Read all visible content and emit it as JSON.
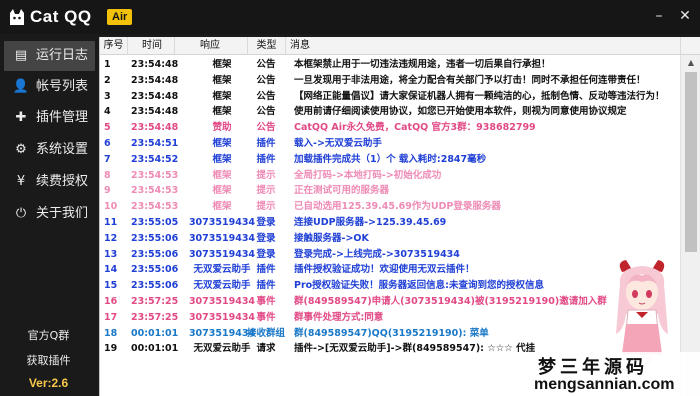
{
  "app": {
    "title": "Cat QQ",
    "badge": "Air",
    "window_controls": {
      "minimize": "–",
      "close": "✕"
    }
  },
  "sidebar": {
    "items": [
      {
        "label": "运行日志",
        "icon": "log-icon",
        "glyph": "▤",
        "active": true
      },
      {
        "label": "帐号列表",
        "icon": "user-icon",
        "glyph": "👤",
        "active": false
      },
      {
        "label": "插件管理",
        "icon": "puzzle-icon",
        "glyph": "✚",
        "active": false
      },
      {
        "label": "系统设置",
        "icon": "gear-icon",
        "glyph": "⚙",
        "active": false
      },
      {
        "label": "续费授权",
        "icon": "yen-icon",
        "glyph": "¥",
        "active": false
      },
      {
        "label": "关于我们",
        "icon": "power-icon",
        "glyph": "⏻",
        "active": false
      }
    ],
    "official_group": "官方Q群",
    "get_plugins": "获取插件",
    "version": "Ver:2.6"
  },
  "log_table": {
    "columns": [
      "序号",
      "时间",
      "响应",
      "类型",
      "消息"
    ],
    "colors": {
      "black": "#111111",
      "pink": "#e24a86",
      "light_pink": "#ee8cb6",
      "blue": "#1f3fd6",
      "red": "#d61818",
      "cyan": "#1a78c8"
    },
    "rows": [
      {
        "idx": "1",
        "time": "23:54:48",
        "resp": "框架",
        "type": "公告",
        "msg": "本框架禁止用于一切违法违规用途，违者一切后果自行承担！",
        "color": "#111111"
      },
      {
        "idx": "2",
        "time": "23:54:48",
        "resp": "框架",
        "type": "公告",
        "msg": "一旦发现用于非法用途，将全力配合有关部门予以打击！同时不承担任何连带责任！",
        "color": "#111111"
      },
      {
        "idx": "3",
        "time": "23:54:48",
        "resp": "框架",
        "type": "公告",
        "msg": "【网络正能量倡议】请大家保证机器人拥有一颗纯洁的心，抵制色情、反动等违法行为！",
        "color": "#111111"
      },
      {
        "idx": "4",
        "time": "23:54:48",
        "resp": "框架",
        "type": "公告",
        "msg": "使用前请仔细阅读使用协议，如您已开始使用本软件，则视为同意使用协议规定",
        "color": "#111111"
      },
      {
        "idx": "5",
        "time": "23:54:48",
        "resp": "赞助",
        "type": "公告",
        "msg": "CatQQ Air永久免费，CatQQ 官方3群：938682799",
        "color": "#e24a86"
      },
      {
        "idx": "6",
        "time": "23:54:51",
        "resp": "框架",
        "type": "插件",
        "msg": "载入->无双爱云助手",
        "color": "#1f3fd6"
      },
      {
        "idx": "7",
        "time": "23:54:52",
        "resp": "框架",
        "type": "插件",
        "msg": "加载插件完成共（1）个 载入耗时:2847毫秒",
        "color": "#1f3fd6"
      },
      {
        "idx": "8",
        "time": "23:54:53",
        "resp": "框架",
        "type": "提示",
        "msg": "全局打码->本地打码->初始化成功",
        "color": "#ee8cb6"
      },
      {
        "idx": "9",
        "time": "23:54:53",
        "resp": "框架",
        "type": "提示",
        "msg": "正在测试可用的服务器",
        "color": "#ee8cb6"
      },
      {
        "idx": "10",
        "time": "23:54:53",
        "resp": "框架",
        "type": "提示",
        "msg": "已自动选用125.39.45.69作为UDP登录服务器",
        "color": "#ee8cb6"
      },
      {
        "idx": "11",
        "time": "23:55:05",
        "resp": "3073519434",
        "type": "登录",
        "msg": "连接UDP服务器->125.39.45.69",
        "color": "#1f3fd6"
      },
      {
        "idx": "12",
        "time": "23:55:06",
        "resp": "3073519434",
        "type": "登录",
        "msg": "接触服务器->OK",
        "color": "#1f3fd6"
      },
      {
        "idx": "13",
        "time": "23:55:06",
        "resp": "3073519434",
        "type": "登录",
        "msg": "登录完成->上线完成->3073519434",
        "color": "#1f3fd6"
      },
      {
        "idx": "14",
        "time": "23:55:06",
        "resp": "无双爱云助手",
        "type": "插件",
        "msg": "插件授权验证成功！欢迎使用无双云插件！",
        "color": "#1f3fd6"
      },
      {
        "idx": "15",
        "time": "23:55:06",
        "resp": "无双爱云助手",
        "type": "插件",
        "msg": "Pro授权验证失败！服务器返回信息:未查询到您的授权信息",
        "color": "#1f3fd6"
      },
      {
        "idx": "16",
        "time": "23:57:25",
        "resp": "3073519434",
        "type": "事件",
        "msg": "群(849589547)申请人(3073519434)被(3195219190)邀请加入群",
        "color": "#e24a86"
      },
      {
        "idx": "17",
        "time": "23:57:25",
        "resp": "3073519434",
        "type": "事件",
        "msg": "群事件处理方式:同意",
        "color": "#e24a86"
      },
      {
        "idx": "18",
        "time": "00:01:01",
        "resp": "3073519434",
        "type": "接收群组",
        "msg": "群(849589547)QQ(3195219190): 菜单",
        "color": "#1a78c8"
      },
      {
        "idx": "19",
        "time": "00:01:01",
        "resp": "无双爱云助手",
        "type": "请求",
        "msg": "插件->[无双爱云助手]->群(849589547): ☆☆☆ 代挂",
        "color": "#111111"
      }
    ]
  },
  "mascot": {
    "name": "mascot-image"
  },
  "watermark": {
    "title": "梦三年源码",
    "url": "mengsannian.com"
  }
}
